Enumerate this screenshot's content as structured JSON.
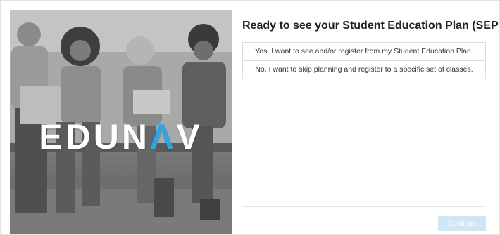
{
  "hero": {
    "logo_part1": "EDUN",
    "logo_accent": "Λ",
    "logo_part2": "V",
    "accent_color": "#2aa6e6"
  },
  "prompt": {
    "title": "Ready to see your Student Education Plan (SEP)?",
    "options": [
      {
        "label": "Yes. I want to see and/or register from my Student Education Plan."
      },
      {
        "label": "No. I want to skip planning and register to a specific set of classes."
      }
    ]
  },
  "footer": {
    "continue_label": "Continue",
    "continue_color": "#cfe6f5"
  }
}
